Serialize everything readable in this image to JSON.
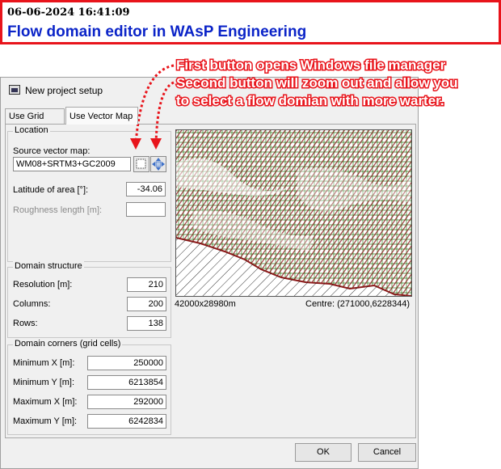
{
  "header": {
    "datetime": "06-06-2024  16:41:09",
    "title": "Flow domain editor in WAsP Engineering"
  },
  "annotation": {
    "lines": [
      "First button opens Windows file manager",
      "Second button will zoom out and allow you",
      "to select a flow domian with more warter."
    ],
    "color": "#e8141b"
  },
  "dialog": {
    "title": "New project setup",
    "tabs": [
      "Use Grid Map",
      "Use Vector Map"
    ],
    "active_tab": "Use Vector Map",
    "location": {
      "group_label": "Location",
      "source_label": "Source vector map:",
      "source_value": "WM08+SRTM3+GC2009",
      "latitude_label": "Latitude of area [°]:",
      "latitude_value": "-34.06",
      "roughness_label": "Roughness length [m]:",
      "roughness_value": ""
    },
    "domain_structure": {
      "group_label": "Domain structure",
      "resolution_label": "Resolution [m]:",
      "resolution_value": "210",
      "columns_label": "Columns:",
      "columns_value": "200",
      "rows_label": "Rows:",
      "rows_value": "138"
    },
    "domain_corners": {
      "group_label": "Domain corners (grid cells)",
      "min_x_label": "Minimum X [m]:",
      "min_x_value": "250000",
      "min_y_label": "Minimum Y [m]:",
      "min_y_value": "6213854",
      "max_x_label": "Maximum X [m]:",
      "max_x_value": "292000",
      "max_y_label": "Maximum Y [m]:",
      "max_y_value": "6242834"
    },
    "map": {
      "size_text": "42000x28980m",
      "centre_text": "Centre: (271000,6228344)",
      "colors": {
        "terrain": "#8b1a1a",
        "contour": "#2f7d1f",
        "sea_hatch": "#000000"
      }
    },
    "buttons": {
      "ok": "OK",
      "cancel": "Cancel"
    }
  }
}
